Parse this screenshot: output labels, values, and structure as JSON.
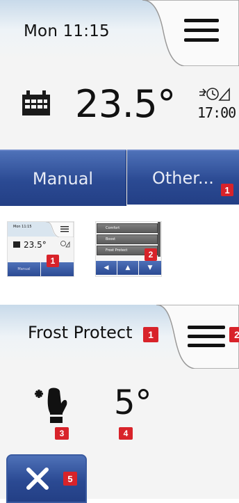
{
  "screen1": {
    "datetime": "Mon 11:15",
    "temperature": "23.5°",
    "next_event_time": "17:00",
    "buttons": {
      "manual": "Manual",
      "other": "Other..."
    },
    "badge": "1"
  },
  "thumbnail1": {
    "datetime": "Mon 11:15",
    "temperature": "23.5°",
    "buttons": {
      "manual": "Manual",
      "other": ""
    },
    "badge": "1"
  },
  "thumbnail2": {
    "items": [
      "Comfort",
      "Boost",
      "Frost Protect"
    ],
    "nav": [
      "◀",
      "▲",
      "▼"
    ],
    "badge": "2"
  },
  "screen3": {
    "title": "Frost Protect",
    "temperature": "5°",
    "badges": {
      "title": "1",
      "menu": "2",
      "mode_icon": "3",
      "temperature": "4",
      "close": "5"
    }
  },
  "colors": {
    "accent_blue": "#2b4a93",
    "badge_red": "#d8232a",
    "background": "#f4f4f4"
  }
}
